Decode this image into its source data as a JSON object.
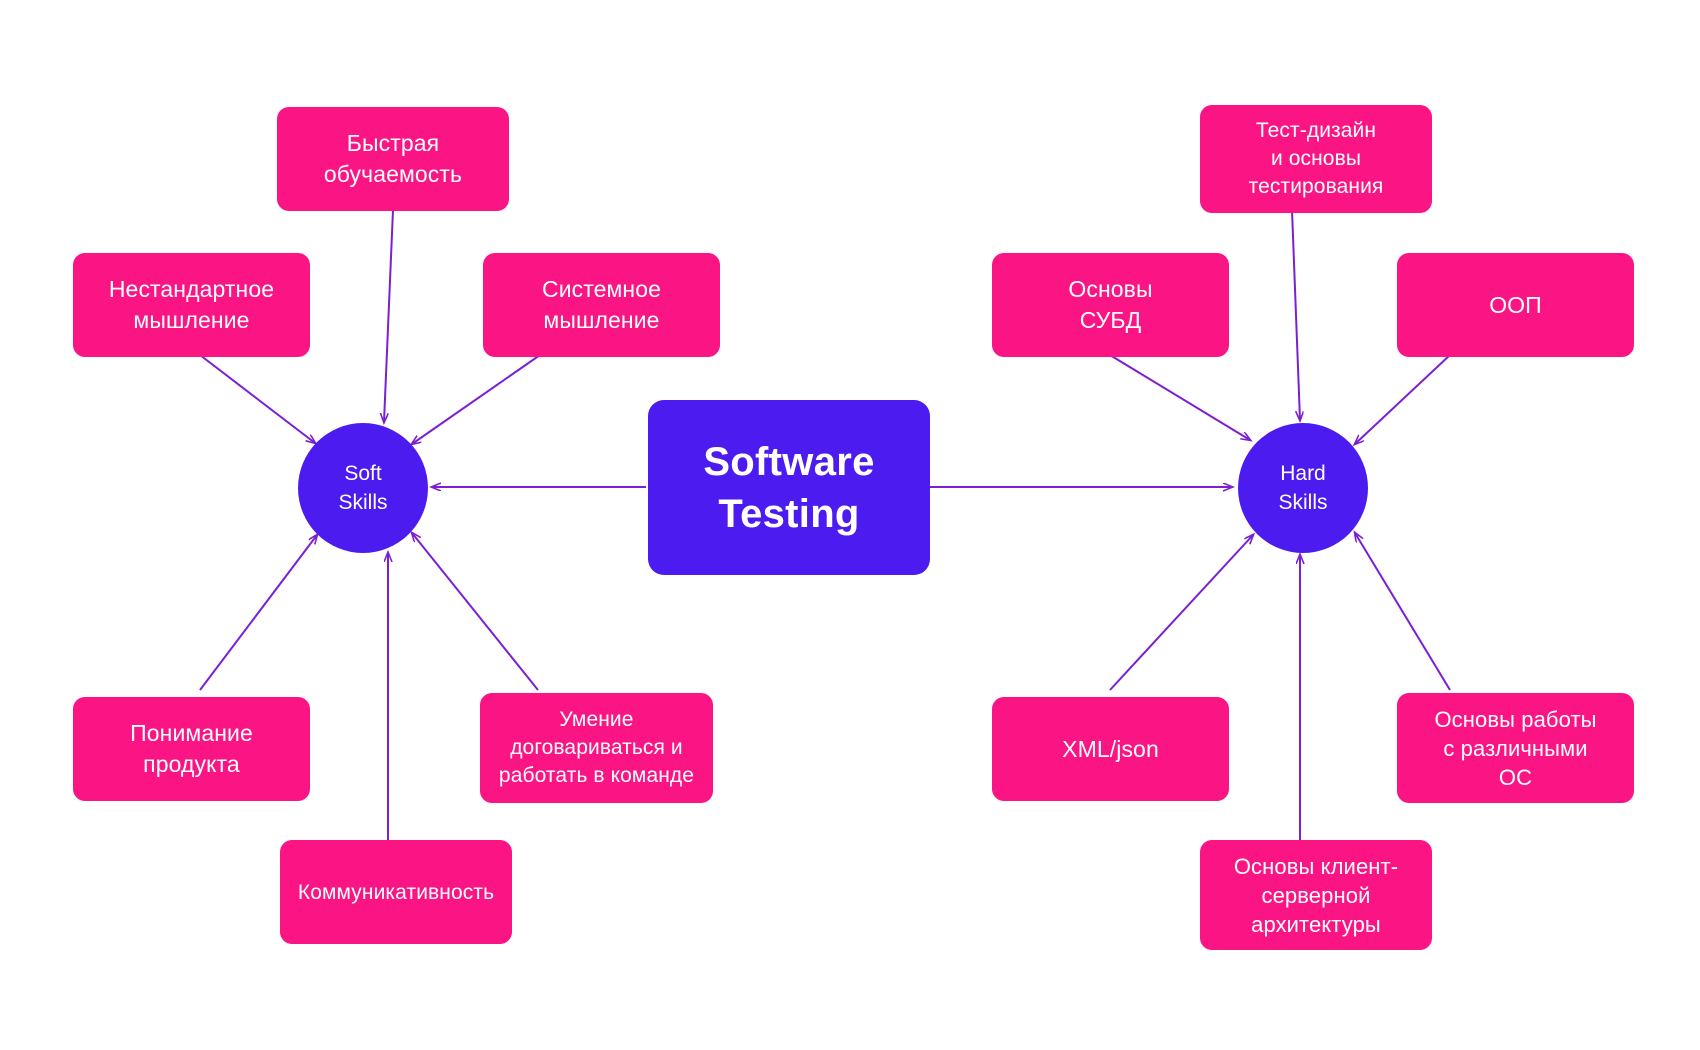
{
  "diagram": {
    "title": "Software Testing skills mind map",
    "colors": {
      "box_pink": "#FA1484",
      "node_purple": "#4B1BF0",
      "arrow_purple": "#7B1FD4",
      "text_white": "#FFFFFF",
      "background": "#FFFFFF"
    },
    "center": {
      "label": "Software Testing",
      "lines": [
        "Software",
        "Testing"
      ]
    },
    "hubs": [
      {
        "id": "soft-skills",
        "label": "Soft Skills",
        "lines": [
          "Soft",
          "Skills"
        ]
      },
      {
        "id": "hard-skills",
        "label": "Hard Skills",
        "lines": [
          "Hard",
          "Skills"
        ]
      }
    ],
    "soft_skills": {
      "hub_label": "Soft Skills",
      "items": [
        {
          "id": "fast-learning",
          "lines": [
            "Быстрая",
            "обучаемость"
          ]
        },
        {
          "id": "nonstandard-thinking",
          "lines": [
            "Нестандартное",
            "мышление"
          ]
        },
        {
          "id": "systems-thinking",
          "lines": [
            "Системное",
            "мышление"
          ]
        },
        {
          "id": "product-understanding",
          "lines": [
            "Понимание",
            "продукта"
          ]
        },
        {
          "id": "teamwork",
          "lines": [
            "Умение",
            "договариваться и",
            "работать в команде"
          ]
        },
        {
          "id": "communication",
          "lines": [
            "Коммуникативность"
          ]
        }
      ]
    },
    "hard_skills": {
      "hub_label": "Hard Skills",
      "items": [
        {
          "id": "test-design",
          "lines": [
            "Тест-дизайн",
            "и основы",
            "тестирования"
          ]
        },
        {
          "id": "dbms-basics",
          "lines": [
            "Основы",
            "СУБД"
          ]
        },
        {
          "id": "oop",
          "lines": [
            "ООП"
          ]
        },
        {
          "id": "xml-json",
          "lines": [
            "XML/json"
          ]
        },
        {
          "id": "os-basics",
          "lines": [
            "Основы работы",
            "с различными",
            "ОС"
          ]
        },
        {
          "id": "client-server",
          "lines": [
            "Основы клиент-",
            "серверной",
            "архитектуры"
          ]
        }
      ]
    }
  }
}
